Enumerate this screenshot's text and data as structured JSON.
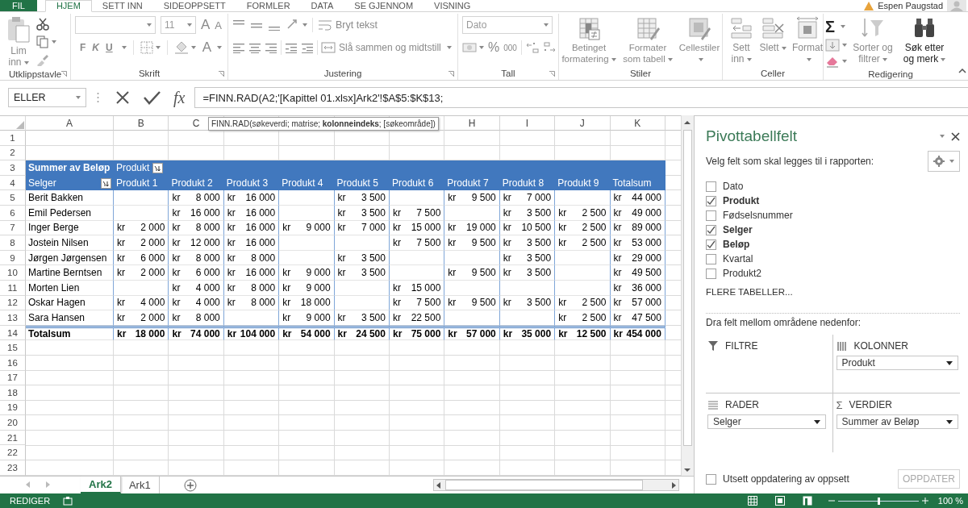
{
  "ribbon": {
    "tabs": [
      {
        "label": "FIL",
        "kind": "file",
        "selected": false
      },
      {
        "label": "HJEM",
        "kind": "tab",
        "selected": true
      },
      {
        "label": "SETT INN",
        "kind": "tab",
        "selected": false
      },
      {
        "label": "SIDEOPPSETT",
        "kind": "tab",
        "selected": false
      },
      {
        "label": "FORMLER",
        "kind": "tab",
        "selected": false
      },
      {
        "label": "DATA",
        "kind": "tab",
        "selected": false
      },
      {
        "label": "SE GJENNOM",
        "kind": "tab",
        "selected": false
      },
      {
        "label": "VISNING",
        "kind": "tab",
        "selected": false
      }
    ],
    "account": {
      "name": "Espen Paugstad"
    },
    "groups": [
      {
        "label": "Utklippstavle",
        "buttons": [
          {
            "label": "Lim inn",
            "disabled": true
          }
        ]
      },
      {
        "label": "Skrift",
        "font_size": "11",
        "buttons": [
          {
            "label": "A",
            "disabled": true
          },
          {
            "label": "A",
            "disabled": true
          },
          {
            "label": "F",
            "disabled": true
          },
          {
            "label": "K",
            "disabled": true
          },
          {
            "label": "U",
            "disabled": true
          },
          {
            "label": "A",
            "disabled": true
          }
        ]
      },
      {
        "label": "Justering",
        "buttons": [
          {
            "label": "Bryt tekst",
            "disabled": true
          },
          {
            "label": "Slå sammen og midtstill",
            "disabled": true
          }
        ]
      },
      {
        "label": "Tall",
        "number_format": "Dato",
        "buttons": [
          {
            "label": "%",
            "disabled": true
          },
          {
            "label": "000",
            "disabled": true
          }
        ]
      },
      {
        "label": "Stiler",
        "buttons": [
          {
            "label": "Betinget formatering",
            "disabled": true
          },
          {
            "label": "Formater som tabell",
            "disabled": true
          },
          {
            "label": "Cellestiler",
            "disabled": true
          }
        ]
      },
      {
        "label": "Celler",
        "buttons": [
          {
            "label": "Sett inn",
            "disabled": true
          },
          {
            "label": "Slett",
            "disabled": true
          },
          {
            "label": "Format",
            "disabled": true
          }
        ]
      },
      {
        "label": "Redigering",
        "buttons": [
          {
            "label": "Σ",
            "disabled": false
          },
          {
            "label": "Sorter og filtrer",
            "disabled": true
          },
          {
            "label": "Søk etter og merk",
            "disabled": false
          }
        ]
      }
    ]
  },
  "formula_bar": {
    "name_box": "ELLER",
    "function_symbol": "fx",
    "formula": "=FINN.RAD(A2;'[Kapittel 01.xlsx]Ark2'!$A$5:$K$13;"
  },
  "tooltip": "FINN.RAD(søkeverdi; matrise; **kolonneindeks**; [søkeområde])",
  "sheet": {
    "column_headers_left": [
      "A",
      "B",
      "C"
    ],
    "column_headers_right": [
      "H",
      "I",
      "J",
      "K"
    ],
    "row_numbers": [
      "1",
      "2",
      "3",
      "4",
      "5",
      "6",
      "7",
      "8",
      "9",
      "10",
      "11",
      "12",
      "13",
      "14",
      "15",
      "16",
      "17",
      "18",
      "19",
      "20",
      "21",
      "22",
      "23"
    ],
    "pivot": {
      "corner": "Summer av Beløp",
      "column_field": "Produkt",
      "row_field": "Selger",
      "headers": [
        "Produkt 1",
        "Produkt 2",
        "Produkt 3",
        "Produkt 4",
        "Produkt 5",
        "Produkt 6",
        "Produkt 7",
        "Produkt 8",
        "Produkt 9",
        "Totalsum"
      ],
      "rows": [
        {
          "label": "Berit Bakken",
          "values": [
            {
              "kind": "empty"
            },
            {
              "kind": "amount",
              "currency": "kr",
              "amount": "8 000"
            },
            {
              "kind": "amount",
              "currency": "kr",
              "amount": "16 000"
            },
            {
              "kind": "empty"
            },
            {
              "kind": "amount",
              "currency": "kr",
              "amount": "3 500"
            },
            {
              "kind": "empty"
            },
            {
              "kind": "amount",
              "currency": "kr",
              "amount": "9 500"
            },
            {
              "kind": "amount",
              "currency": "kr",
              "amount": "7 000"
            },
            {
              "kind": "empty"
            },
            {
              "kind": "amount",
              "currency": "kr",
              "amount": "44 000"
            }
          ]
        },
        {
          "label": "Emil Pedersen",
          "values": [
            {
              "kind": "empty"
            },
            {
              "kind": "amount",
              "currency": "kr",
              "amount": "16 000"
            },
            {
              "kind": "amount",
              "currency": "kr",
              "amount": "16 000"
            },
            {
              "kind": "empty"
            },
            {
              "kind": "amount",
              "currency": "kr",
              "amount": "3 500"
            },
            {
              "kind": "amount",
              "currency": "kr",
              "amount": "7 500"
            },
            {
              "kind": "empty"
            },
            {
              "kind": "amount",
              "currency": "kr",
              "amount": "3 500"
            },
            {
              "kind": "amount",
              "currency": "kr",
              "amount": "2 500"
            },
            {
              "kind": "amount",
              "currency": "kr",
              "amount": "49 000"
            }
          ]
        },
        {
          "label": "Inger Berge",
          "values": [
            {
              "kind": "amount",
              "currency": "kr",
              "amount": "2 000"
            },
            {
              "kind": "amount",
              "currency": "kr",
              "amount": "8 000"
            },
            {
              "kind": "amount",
              "currency": "kr",
              "amount": "16 000"
            },
            {
              "kind": "amount",
              "currency": "kr",
              "amount": "9 000"
            },
            {
              "kind": "amount",
              "currency": "kr",
              "amount": "7 000"
            },
            {
              "kind": "amount",
              "currency": "kr",
              "amount": "15 000"
            },
            {
              "kind": "amount",
              "currency": "kr",
              "amount": "19 000"
            },
            {
              "kind": "amount",
              "currency": "kr",
              "amount": "10 500"
            },
            {
              "kind": "amount",
              "currency": "kr",
              "amount": "2 500"
            },
            {
              "kind": "amount",
              "currency": "kr",
              "amount": "89 000"
            }
          ]
        },
        {
          "label": "Jostein Nilsen",
          "values": [
            {
              "kind": "amount",
              "currency": "kr",
              "amount": "2 000"
            },
            {
              "kind": "amount",
              "currency": "kr",
              "amount": "12 000"
            },
            {
              "kind": "amount",
              "currency": "kr",
              "amount": "16 000"
            },
            {
              "kind": "empty"
            },
            {
              "kind": "empty"
            },
            {
              "kind": "amount",
              "currency": "kr",
              "amount": "7 500"
            },
            {
              "kind": "amount",
              "currency": "kr",
              "amount": "9 500"
            },
            {
              "kind": "amount",
              "currency": "kr",
              "amount": "3 500"
            },
            {
              "kind": "amount",
              "currency": "kr",
              "amount": "2 500"
            },
            {
              "kind": "amount",
              "currency": "kr",
              "amount": "53 000"
            }
          ]
        },
        {
          "label": "Jørgen Jørgensen",
          "values": [
            {
              "kind": "amount",
              "currency": "kr",
              "amount": "6 000"
            },
            {
              "kind": "amount",
              "currency": "kr",
              "amount": "8 000"
            },
            {
              "kind": "amount",
              "currency": "kr",
              "amount": "8 000"
            },
            {
              "kind": "empty"
            },
            {
              "kind": "amount",
              "currency": "kr",
              "amount": "3 500"
            },
            {
              "kind": "empty"
            },
            {
              "kind": "empty"
            },
            {
              "kind": "amount",
              "currency": "kr",
              "amount": "3 500"
            },
            {
              "kind": "empty"
            },
            {
              "kind": "amount",
              "currency": "kr",
              "amount": "29 000"
            }
          ]
        },
        {
          "label": "Martine Berntsen",
          "values": [
            {
              "kind": "amount",
              "currency": "kr",
              "amount": "2 000"
            },
            {
              "kind": "amount",
              "currency": "kr",
              "amount": "6 000"
            },
            {
              "kind": "amount",
              "currency": "kr",
              "amount": "16 000"
            },
            {
              "kind": "amount",
              "currency": "kr",
              "amount": "9 000"
            },
            {
              "kind": "amount",
              "currency": "kr",
              "amount": "3 500"
            },
            {
              "kind": "empty"
            },
            {
              "kind": "amount",
              "currency": "kr",
              "amount": "9 500"
            },
            {
              "kind": "amount",
              "currency": "kr",
              "amount": "3 500"
            },
            {
              "kind": "empty"
            },
            {
              "kind": "amount",
              "currency": "kr",
              "amount": "49 500"
            }
          ]
        },
        {
          "label": "Morten Lien",
          "values": [
            {
              "kind": "empty"
            },
            {
              "kind": "amount",
              "currency": "kr",
              "amount": "4 000"
            },
            {
              "kind": "amount",
              "currency": "kr",
              "amount": "8 000"
            },
            {
              "kind": "amount",
              "currency": "kr",
              "amount": "9 000"
            },
            {
              "kind": "empty"
            },
            {
              "kind": "amount",
              "currency": "kr",
              "amount": "15 000"
            },
            {
              "kind": "empty"
            },
            {
              "kind": "empty"
            },
            {
              "kind": "empty"
            },
            {
              "kind": "amount",
              "currency": "kr",
              "amount": "36 000"
            }
          ]
        },
        {
          "label": "Oskar Hagen",
          "values": [
            {
              "kind": "amount",
              "currency": "kr",
              "amount": "4 000"
            },
            {
              "kind": "amount",
              "currency": "kr",
              "amount": "4 000"
            },
            {
              "kind": "amount",
              "currency": "kr",
              "amount": "8 000"
            },
            {
              "kind": "amount",
              "currency": "kr",
              "amount": "18 000"
            },
            {
              "kind": "empty"
            },
            {
              "kind": "amount",
              "currency": "kr",
              "amount": "7 500"
            },
            {
              "kind": "amount",
              "currency": "kr",
              "amount": "9 500"
            },
            {
              "kind": "amount",
              "currency": "kr",
              "amount": "3 500"
            },
            {
              "kind": "amount",
              "currency": "kr",
              "amount": "2 500"
            },
            {
              "kind": "amount",
              "currency": "kr",
              "amount": "57 000"
            }
          ]
        },
        {
          "label": "Sara Hansen",
          "values": [
            {
              "kind": "amount",
              "currency": "kr",
              "amount": "2 000"
            },
            {
              "kind": "amount",
              "currency": "kr",
              "amount": "8 000"
            },
            {
              "kind": "empty"
            },
            {
              "kind": "amount",
              "currency": "kr",
              "amount": "9 000"
            },
            {
              "kind": "amount",
              "currency": "kr",
              "amount": "3 500"
            },
            {
              "kind": "amount",
              "currency": "kr",
              "amount": "22 500"
            },
            {
              "kind": "empty"
            },
            {
              "kind": "empty"
            },
            {
              "kind": "amount",
              "currency": "kr",
              "amount": "2 500"
            },
            {
              "kind": "amount",
              "currency": "kr",
              "amount": "47 500"
            }
          ]
        }
      ],
      "total": {
        "label": "Totalsum",
        "values": [
          {
            "kind": "amount",
            "currency": "kr",
            "amount": "18 000"
          },
          {
            "kind": "amount",
            "currency": "kr",
            "amount": "74 000"
          },
          {
            "kind": "amount",
            "currency": "kr",
            "amount": "104 000"
          },
          {
            "kind": "amount",
            "currency": "kr",
            "amount": "54 000"
          },
          {
            "kind": "amount",
            "currency": "kr",
            "amount": "24 500"
          },
          {
            "kind": "amount",
            "currency": "kr",
            "amount": "75 000"
          },
          {
            "kind": "amount",
            "currency": "kr",
            "amount": "57 000"
          },
          {
            "kind": "amount",
            "currency": "kr",
            "amount": "35 000"
          },
          {
            "kind": "amount",
            "currency": "kr",
            "amount": "12 500"
          },
          {
            "kind": "amount",
            "currency": "kr",
            "amount": "454 000"
          }
        ]
      }
    }
  },
  "sheet_tabs": [
    {
      "label": "Ark2",
      "selected": true
    },
    {
      "label": "Ark1",
      "selected": false
    }
  ],
  "status_bar": {
    "mode": "REDIGER",
    "zoom": {
      "level": 0.5,
      "reading": "100 %"
    }
  },
  "field_pane": {
    "title": "Pivottabellfelt",
    "prompt": "Velg felt som skal legges til i rapporten:",
    "fields": [
      {
        "label": "Dato",
        "checked": false
      },
      {
        "label": "Produkt",
        "checked": true
      },
      {
        "label": "Fødselsnummer",
        "checked": false
      },
      {
        "label": "Selger",
        "checked": true
      },
      {
        "label": "Beløp",
        "checked": true
      },
      {
        "label": "Kvartal",
        "checked": false
      },
      {
        "label": "Produkt2",
        "checked": false
      }
    ],
    "more_tables": "FLERE TABELLER...",
    "areas_prompt": "Dra felt mellom områdene nedenfor:",
    "areas": [
      {
        "kind": "filters",
        "label": "FILTRE"
      },
      {
        "kind": "columns",
        "label": "KOLONNER",
        "field": "Produkt"
      },
      {
        "kind": "rows",
        "label": "RADER",
        "field": "Selger"
      },
      {
        "kind": "values",
        "label": "VERDIER",
        "symbol": "Σ",
        "field": "Summer av Beløp"
      }
    ],
    "defer": {
      "label": "Utsett oppdatering av oppsett",
      "checked": false
    },
    "update_button": {
      "label": "OPPDATER",
      "disabled": true
    }
  }
}
